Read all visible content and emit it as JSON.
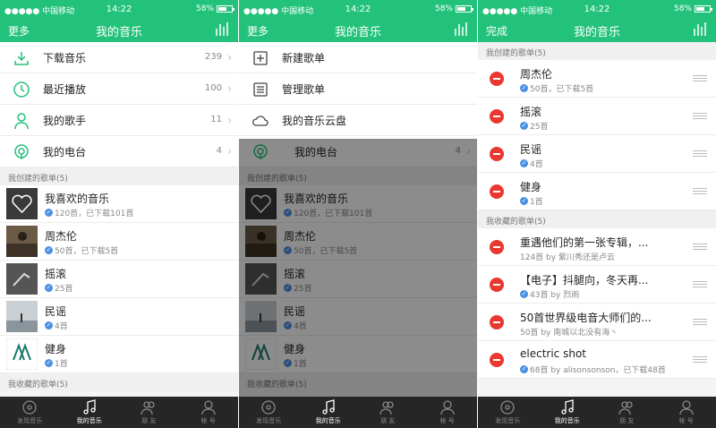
{
  "status": {
    "carrier": "●●●●● 中国移动 ",
    "time": "14:22",
    "battery": "58%"
  },
  "nav": {
    "more": "更多",
    "done": "完成",
    "title": "我的音乐"
  },
  "menu": [
    {
      "label": "下载音乐",
      "count": "239"
    },
    {
      "label": "最近播放",
      "count": "100"
    },
    {
      "label": "我的歌手",
      "count": "11"
    },
    {
      "label": "我的电台",
      "count": "4"
    }
  ],
  "popup": [
    {
      "label": "新建歌单"
    },
    {
      "label": "管理歌单"
    },
    {
      "label": "我的音乐云盘"
    }
  ],
  "sections": {
    "created": "我创建的歌单(5)",
    "collected": "我收藏的歌单(5)"
  },
  "created_playlists": [
    {
      "name": "我喜欢的音乐",
      "sub": "120首，已下载101首"
    },
    {
      "name": "周杰伦",
      "sub": "50首，已下载5首"
    },
    {
      "name": "摇滚",
      "sub": "25首"
    },
    {
      "name": "民谣",
      "sub": "4首"
    },
    {
      "name": "健身",
      "sub": "1首"
    }
  ],
  "collected_playlists": [
    {
      "name": "重遇他们的第一张专辑，...",
      "sub": "124首  by 紫川秀还是卢云"
    },
    {
      "name": "【电子】抖腿向，冬天再...",
      "sub": "43首  by 烈雨"
    },
    {
      "name": "50首世界级电音大师们的...",
      "sub": "50首  by 南城以北没有海丶"
    },
    {
      "name": "electric shot",
      "sub": "68首  by alisonsonson，已下载48首"
    }
  ],
  "tabs": [
    {
      "label": "发现音乐"
    },
    {
      "label": "我的音乐"
    },
    {
      "label": "朋 友"
    },
    {
      "label": "帐 号"
    }
  ],
  "colors": {
    "accent": "#23c27a",
    "tabbar": "#262626",
    "delete": "#e8382f",
    "check": "#4a90e2"
  }
}
